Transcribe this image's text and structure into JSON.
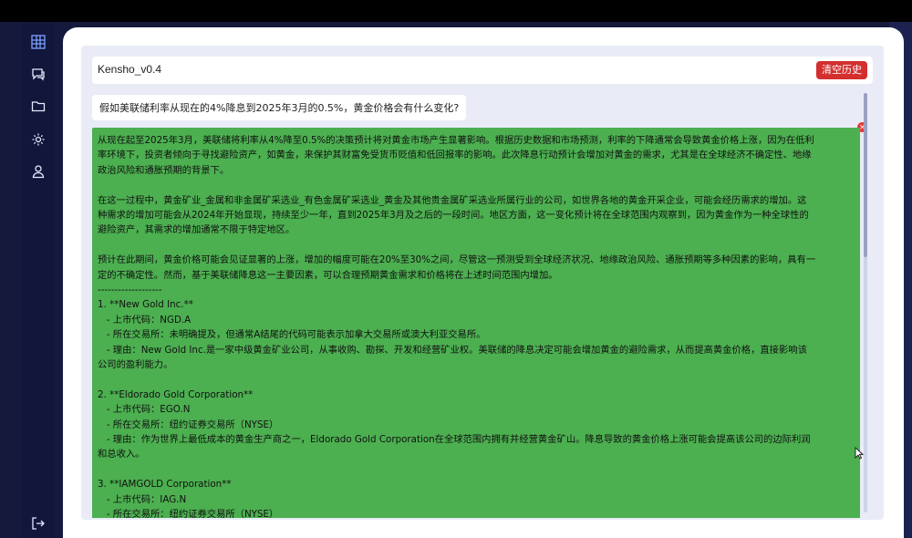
{
  "app": {
    "title": "Kensho_v0.4",
    "clear_label": "清空历史"
  },
  "sidebar": {
    "icons": [
      "grid-icon",
      "chat-icon",
      "folder-icon",
      "settings-icon",
      "user-icon",
      "logout-icon"
    ]
  },
  "chat": {
    "user_message": "假如美联储利率从现在的4%降息到2025年3月的0.5%，黄金价格会有什么变化?",
    "answer_paragraphs": [
      [
        "从现在起至2025年3月，美联储将利率从4%降至0.5%的决策预计将对黄金市场产生显著影响。根据历史数据和市场预测，利率的下降通常会导致黄金价格上涨，因为在低利",
        "率环境下，投资者倾向于寻找避险资产，如黄金，来保护其财富免受货币贬值和低回报率的影响。此次降息行动预计会增加对黄金的需求，尤其是在全球经济不确定性、地缘",
        "政治风险和通胀预期的背景下。"
      ],
      [
        "在这一过程中，黄金矿业_金属和非金属矿采选业_有色金属矿采选业_黄金及其他贵金属矿采选业所属行业的公司，如世界各地的黄金开采企业，可能会经历需求的增加。这",
        "种需求的增加可能会从2024年开始显现，持续至少一年，直到2025年3月及之后的一段时间。地区方面，这一变化预计将在全球范围内观察到，因为黄金作为一种全球性的",
        "避险资产，其需求的增加通常不限于特定地区。"
      ],
      [
        "预计在此期间，黄金价格可能会见证显著的上涨，增加的幅度可能在20%至30%之间，尽管这一预测受到全球经济状况、地缘政治风险、通胀预期等多种因素的影响，具有一",
        "定的不确定性。然而，基于美联储降息这一主要因素，可以合理预期黄金需求和价格将在上述时间范围内增加。",
        "-------------------",
        "1. **New Gold Inc.**",
        "   - 上市代码：NGD.A",
        "   - 所在交易所：未明确提及，但通常A结尾的代码可能表示加拿大交易所或澳大利亚交易所。",
        "   - 理由：New Gold Inc.是一家中级黄金矿业公司，从事收购、勘探、开发和经营矿业权。美联储的降息决定可能会增加黄金的避险需求，从而提高黄金价格，直接影响该",
        "公司的盈利能力。"
      ],
      [
        "2. **Eldorado Gold Corporation**",
        "   - 上市代码：EGO.N",
        "   - 所在交易所：纽约证券交易所（NYSE）",
        "   - 理由：作为世界上最低成本的黄金生产商之一，Eldorado Gold Corporation在全球范围内拥有并经营黄金矿山。降息导致的黄金价格上涨可能会提高该公司的边际利润",
        "和总收入。"
      ],
      [
        "3. **IAMGOLD Corporation**",
        "   - 上市代码：IAG.N",
        "   - 所在交易所：纽约证券交易所（NYSE）"
      ]
    ]
  },
  "colors": {
    "accent_green": "#4caf50",
    "clear_red": "#d32f2f",
    "sidebar_bg": "#11163a"
  }
}
